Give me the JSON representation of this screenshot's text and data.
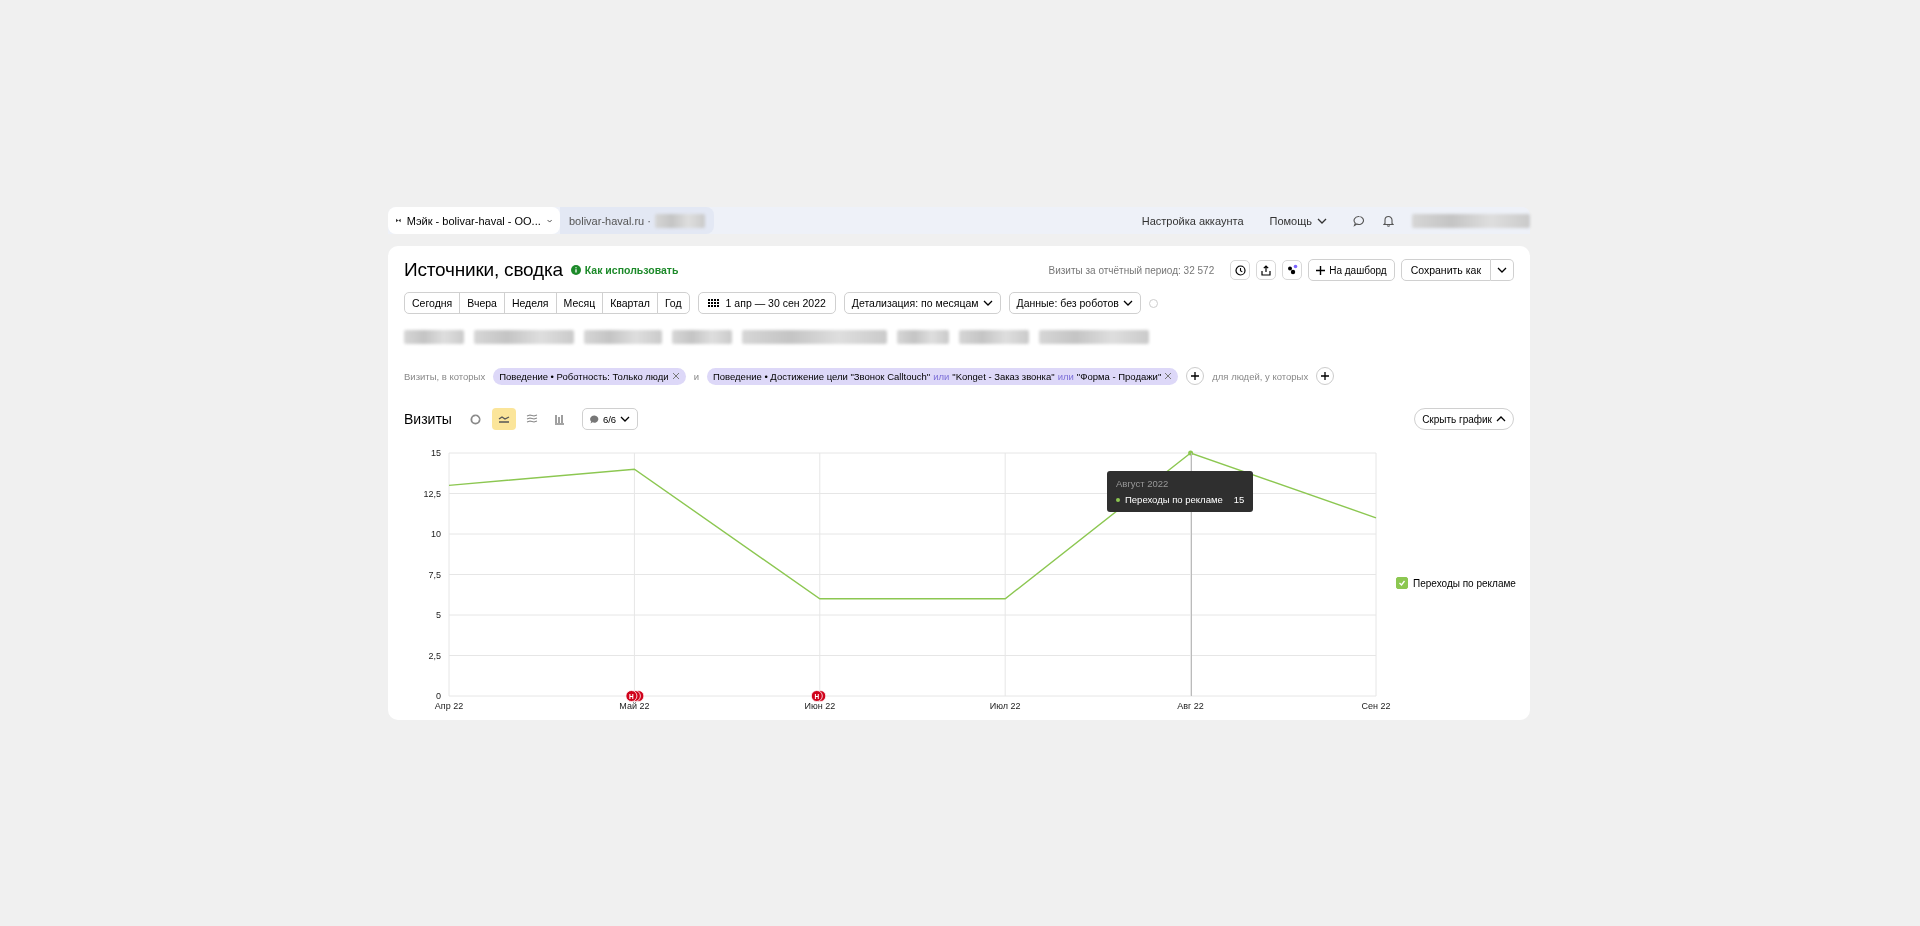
{
  "header": {
    "counter_tab": "Мэйк - bolivar-haval - ОО...",
    "site": "bolivar-haval.ru ·",
    "links": [
      "Настройка аккаунта",
      "Помощь"
    ]
  },
  "report": {
    "title": "Источники, сводка",
    "help_link": "Как использовать",
    "visits_total": "Визиты за отчётный период: 32 572",
    "dashboard_button": "На дашборд",
    "save_button": "Сохранить как"
  },
  "periods": [
    {
      "label": "Сегодня",
      "selected": false
    },
    {
      "label": "Вчера",
      "selected": false
    },
    {
      "label": "Неделя",
      "selected": false
    },
    {
      "label": "Месяц",
      "selected": false
    },
    {
      "label": "Квартал",
      "selected": false
    },
    {
      "label": "Год",
      "selected": false
    }
  ],
  "date_range": "1 апр — 30 сен 2022",
  "detail_dropdown": "Детализация: по месяцам",
  "data_dropdown": "Данные: без роботов",
  "segments": {
    "prefix": "Визиты, в которых",
    "joiner": "и",
    "suffix": "для людей, у которых",
    "chips": [
      {
        "parts": [
          {
            "kind": "value",
            "text": "Поведение • Роботность: Только люди"
          }
        ]
      },
      {
        "parts": [
          {
            "kind": "value",
            "text": "Поведение • Достижение цели \"Звонок Calltouch\""
          },
          {
            "kind": "connector",
            "text": "или"
          },
          {
            "kind": "value",
            "text": "\"Konget - Заказ звонка\""
          },
          {
            "kind": "connector",
            "text": "или"
          },
          {
            "kind": "value",
            "text": "\"Форма - Продажи\""
          }
        ]
      }
    ]
  },
  "chart_section": {
    "title": "Визиты",
    "chart_types": [
      {
        "kind": "pie",
        "selected": false
      },
      {
        "kind": "line",
        "selected": true
      },
      {
        "kind": "area",
        "selected": false
      },
      {
        "kind": "bar",
        "selected": false
      }
    ],
    "notes_dropdown": "6/6",
    "hide_button": "Скрыть график",
    "tooltip": {
      "title": "Август 2022",
      "series": "Переходы по рекламе",
      "value": "15"
    },
    "legend": [
      {
        "checked": true
      }
    ],
    "chart_data": {
      "type": "line",
      "categories": [
        "Апр 22",
        "Май 22",
        "Июн 22",
        "Июл 22",
        "Авг 22",
        "Сен 22"
      ],
      "series": [
        {
          "name": "Переходы по рекламе",
          "color": "#8cc751",
          "values": [
            13,
            14,
            6,
            6,
            15,
            11
          ]
        }
      ],
      "ylim": [
        0,
        15
      ],
      "grid": true,
      "yticks": [
        {
          "value": 0,
          "label": "0"
        },
        {
          "value": 2.5,
          "label": "2,5"
        },
        {
          "value": 5,
          "label": "5"
        },
        {
          "value": 7.5,
          "label": "7,5"
        },
        {
          "value": 10,
          "label": "10"
        },
        {
          "value": 12.5,
          "label": "12,5"
        },
        {
          "value": 15,
          "label": "15"
        }
      ],
      "annotations": [
        "Н",
        "Н"
      ]
    }
  }
}
